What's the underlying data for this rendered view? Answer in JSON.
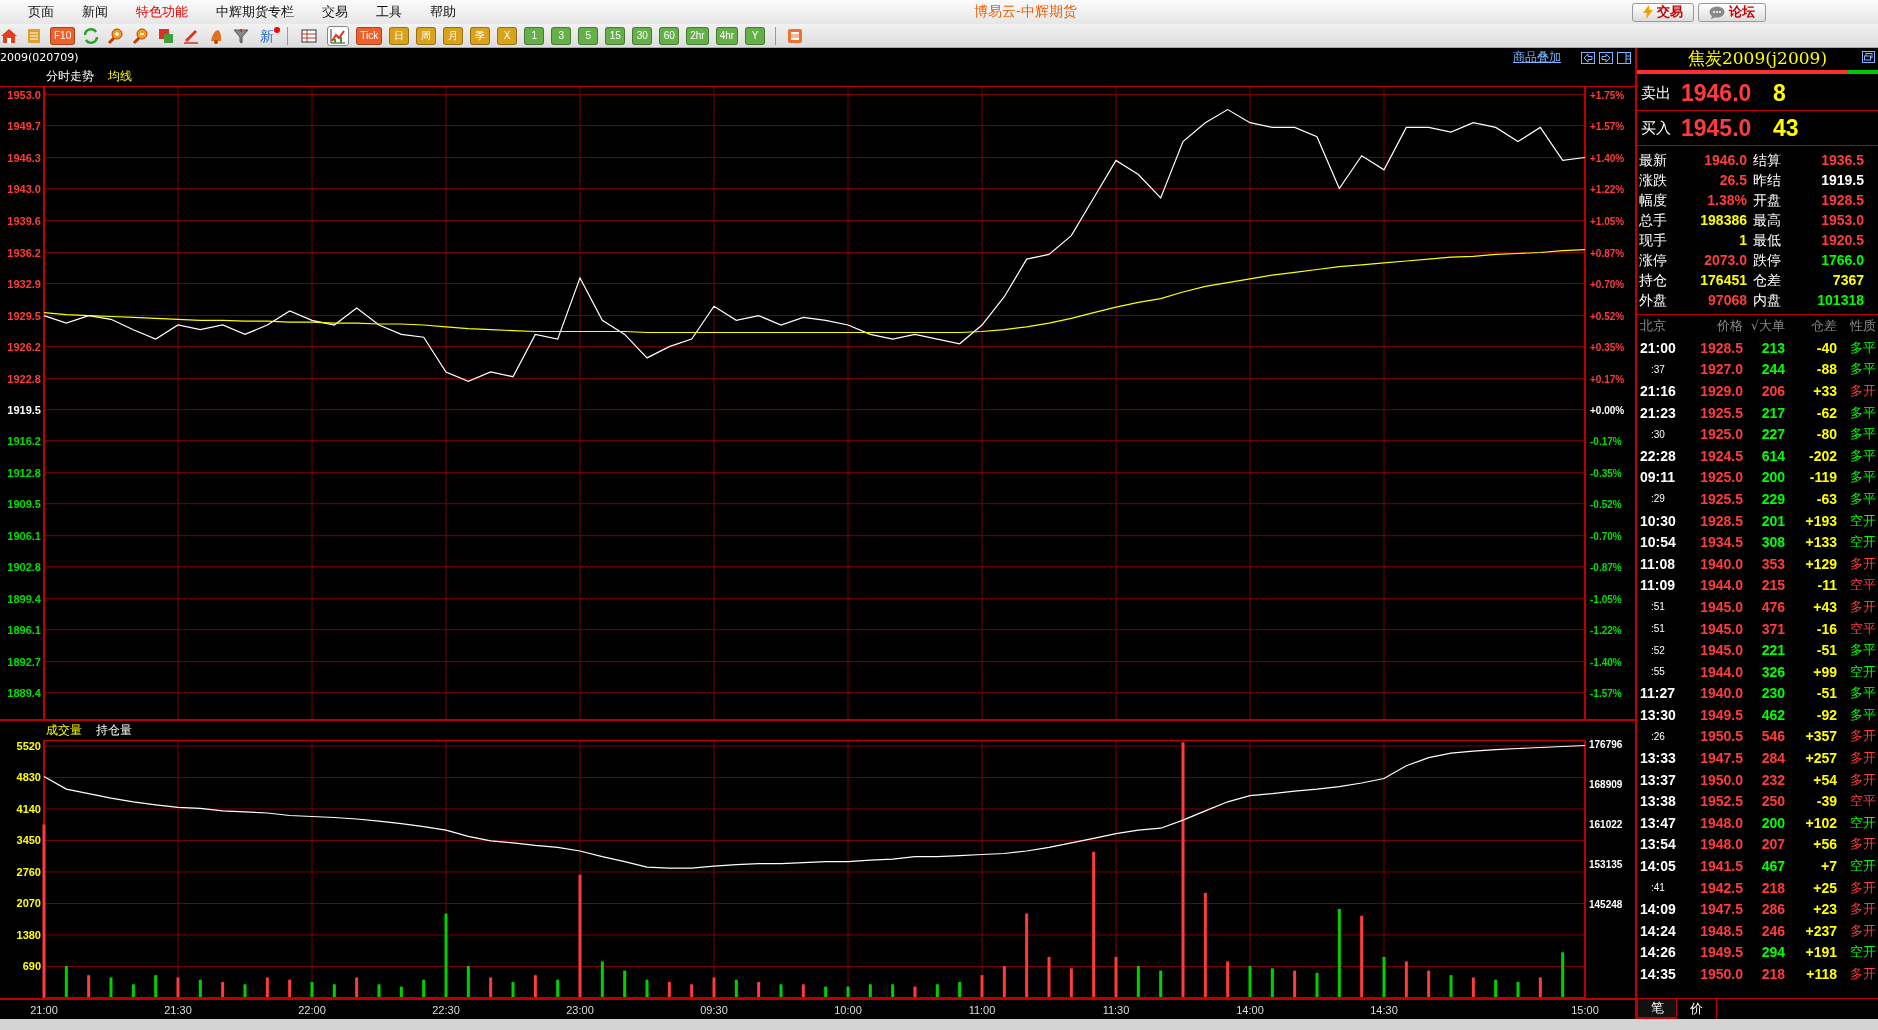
{
  "menu": [
    {
      "label": "页面",
      "highlighted": false
    },
    {
      "label": "新闻",
      "highlighted": false
    },
    {
      "label": "特色功能",
      "highlighted": true
    },
    {
      "label": "中辉期货专栏",
      "highlighted": false
    },
    {
      "label": "交易",
      "highlighted": false
    },
    {
      "label": "工具",
      "highlighted": false
    },
    {
      "label": "帮助",
      "highlighted": false
    }
  ],
  "window": {
    "title": "博易云-中辉期货"
  },
  "header_buttons": [
    {
      "label": "交易"
    },
    {
      "label": "论坛"
    }
  ],
  "toolbar": {
    "f10_label": "F10",
    "news_label": "新",
    "views": [
      {
        "selected": false
      },
      {
        "selected": true
      }
    ],
    "periods": [
      {
        "label": "Tick",
        "kind": "tick"
      },
      {
        "label": "日",
        "kind": "calendar"
      },
      {
        "label": "周",
        "kind": "calendar"
      },
      {
        "label": "月",
        "kind": "calendar"
      },
      {
        "label": "季",
        "kind": "calendar"
      },
      {
        "label": "X",
        "kind": "calendar"
      },
      {
        "label": "1",
        "kind": "minute"
      },
      {
        "label": "3",
        "kind": "minute"
      },
      {
        "label": "5",
        "kind": "minute"
      },
      {
        "label": "15",
        "kind": "minute"
      },
      {
        "label": "30",
        "kind": "minute"
      },
      {
        "label": "60",
        "kind": "minute"
      },
      {
        "label": "2hr",
        "kind": "minute"
      },
      {
        "label": "4hr",
        "kind": "minute"
      },
      {
        "label": "Y",
        "kind": "minute"
      }
    ]
  },
  "chart_title": "2009(020709)",
  "overlay_link": "商品叠加",
  "price_chart": {
    "right_labels": [
      {
        "text": "+1.75%",
        "kind": "up"
      },
      {
        "text": "+1.57%",
        "kind": "up"
      },
      {
        "text": "+1.40%",
        "kind": "up"
      },
      {
        "text": "+1.22%",
        "kind": "up"
      },
      {
        "text": "+1.05%",
        "kind": "up"
      },
      {
        "text": "+0.87%",
        "kind": "up"
      },
      {
        "text": "+0.70%",
        "kind": "up"
      },
      {
        "text": "+0.52%",
        "kind": "up"
      },
      {
        "text": "+0.35%",
        "kind": "up"
      },
      {
        "text": "+0.17%",
        "kind": "up"
      },
      {
        "text": "+0.00%",
        "kind": "flat"
      },
      {
        "text": "-0.17%",
        "kind": "down"
      },
      {
        "text": "-0.35%",
        "kind": "down"
      },
      {
        "text": "-0.52%",
        "kind": "down"
      },
      {
        "text": "-0.70%",
        "kind": "down"
      },
      {
        "text": "-0.87%",
        "kind": "down"
      },
      {
        "text": "-1.05%",
        "kind": "down"
      },
      {
        "text": "-1.22%",
        "kind": "down"
      },
      {
        "text": "-1.40%",
        "kind": "down"
      },
      {
        "text": "-1.57%",
        "kind": "down"
      }
    ],
    "chart_data": {
      "type": "line",
      "grid": true,
      "ylim": [
        1886.5,
        1953.8
      ],
      "yticks": [
        {
          "value": 1953.0,
          "label": "1953.0"
        },
        1949.7,
        1946.3,
        {
          "value": 1943.0,
          "label": "1943.0"
        },
        1939.6,
        1936.2,
        1932.9,
        1929.5,
        1926.2,
        1922.8,
        1919.5,
        1916.2,
        1912.8,
        1909.5,
        1906.1,
        1902.8,
        1899.4,
        1896.1,
        1892.7,
        1889.4
      ],
      "categories": [
        null,
        null,
        null,
        null,
        null,
        null,
        null,
        null,
        null,
        null,
        null,
        null,
        null,
        null,
        null,
        null,
        null,
        null,
        null,
        null,
        null,
        null,
        null,
        null,
        null,
        null,
        null,
        null,
        null,
        null,
        null,
        null,
        null,
        null,
        null,
        null,
        null,
        null,
        null,
        null,
        null,
        null,
        null,
        null,
        null,
        null,
        null,
        null,
        null,
        null,
        null,
        null,
        null,
        null,
        null,
        null,
        null,
        null,
        null,
        null,
        null,
        null,
        null,
        null,
        null,
        null,
        null,
        null,
        null,
        null
      ],
      "series": [
        {
          "name": "分时走势",
          "color": "#ffffff",
          "values": [
            1929.5,
            1928.7,
            1929.5,
            1929.1,
            1928.0,
            1927.0,
            1928.5,
            1928.0,
            1928.5,
            1927.5,
            1928.5,
            1930.0,
            1929.0,
            1928.5,
            1930.3,
            1928.5,
            1927.5,
            1927.2,
            1923.5,
            1922.5,
            1923.5,
            1923.0,
            1927.5,
            1927.0,
            1933.5,
            1929.0,
            1927.5,
            1925.0,
            1926.2,
            1927.0,
            1930.5,
            1929.0,
            1929.5,
            1928.5,
            1929.3,
            1929.0,
            1928.5,
            1927.5,
            1927.0,
            1927.5,
            1927.0,
            1926.5,
            1928.5,
            1931.5,
            1935.5,
            1936.0,
            1938.0,
            1942.0,
            1946.0,
            1944.5,
            1942.0,
            1948.0,
            1950.0,
            1951.4,
            1950.0,
            1949.5,
            1949.5,
            1948.5,
            1943.0,
            1946.5,
            1945.0,
            1949.5,
            1949.5,
            1949.0,
            1950.0,
            1949.5,
            1948.0,
            1949.5,
            1946.0,
            1946.3
          ]
        },
        {
          "name": "均线",
          "color": "#ffff00",
          "values": [
            1929.8,
            1929.6,
            1929.5,
            1929.4,
            1929.3,
            1929.2,
            1929.1,
            1929.0,
            1929.0,
            1928.9,
            1928.9,
            1928.8,
            1928.8,
            1928.7,
            1928.7,
            1928.6,
            1928.6,
            1928.5,
            1928.3,
            1928.1,
            1928.0,
            1927.9,
            1927.8,
            1927.8,
            1927.8,
            1927.8,
            1927.8,
            1927.7,
            1927.7,
            1927.7,
            1927.7,
            1927.7,
            1927.7,
            1927.7,
            1927.7,
            1927.7,
            1927.7,
            1927.7,
            1927.7,
            1927.7,
            1927.7,
            1927.7,
            1927.8,
            1928.0,
            1928.3,
            1928.7,
            1929.2,
            1929.8,
            1930.4,
            1930.9,
            1931.3,
            1932.0,
            1932.6,
            1933.0,
            1933.4,
            1933.8,
            1934.1,
            1934.4,
            1934.7,
            1934.9,
            1935.1,
            1935.3,
            1935.5,
            1935.7,
            1935.8,
            1936.0,
            1936.1,
            1936.2,
            1936.4,
            1936.5
          ]
        }
      ]
    }
  },
  "volume_chart": {
    "chart_data": {
      "type": "bar",
      "grid": true,
      "ylim": [
        0,
        5650
      ],
      "yticks": [
        5520,
        4830,
        4140,
        3450,
        2760,
        2070,
        1380,
        690
      ],
      "categories": [
        "21:00",
        null,
        null,
        null,
        null,
        null,
        "21:30",
        null,
        null,
        null,
        null,
        null,
        "22:00",
        null,
        null,
        null,
        null,
        null,
        "22:30",
        null,
        null,
        null,
        null,
        null,
        "23:00",
        null,
        null,
        null,
        null,
        null,
        "09:30",
        null,
        null,
        null,
        null,
        null,
        "10:00",
        null,
        null,
        null,
        null,
        null,
        "11:00",
        null,
        null,
        null,
        null,
        null,
        "11:30",
        null,
        null,
        null,
        null,
        null,
        "14:00",
        null,
        null,
        null,
        null,
        null,
        "14:30",
        null,
        null,
        null,
        null,
        null,
        null,
        null,
        null,
        "15:00"
      ],
      "series": [
        {
          "name": "成交量",
          "color": "#ff3c3c",
          "values": [
            3800,
            null,
            500,
            null,
            null,
            null,
            450,
            null,
            350,
            null,
            450,
            400,
            null,
            null,
            450,
            null,
            null,
            null,
            null,
            null,
            450,
            null,
            500,
            null,
            2700,
            null,
            null,
            null,
            350,
            300,
            450,
            null,
            350,
            null,
            300,
            null,
            null,
            null,
            null,
            250,
            null,
            null,
            500,
            700,
            1850,
            900,
            650,
            3200,
            900,
            null,
            null,
            5600,
            2300,
            800,
            null,
            null,
            600,
            null,
            null,
            1800,
            null,
            800,
            600,
            null,
            450,
            null,
            null,
            450,
            null,
            null
          ]
        },
        {
          "color": "#00d000",
          "values": [
            null,
            700,
            null,
            450,
            300,
            500,
            null,
            400,
            null,
            300,
            null,
            null,
            350,
            300,
            null,
            300,
            250,
            400,
            1850,
            700,
            null,
            350,
            null,
            400,
            null,
            800,
            600,
            400,
            null,
            null,
            null,
            400,
            null,
            300,
            null,
            250,
            250,
            300,
            300,
            null,
            300,
            350,
            null,
            null,
            null,
            null,
            null,
            null,
            null,
            700,
            600,
            null,
            null,
            null,
            700,
            650,
            null,
            550,
            1950,
            null,
            900,
            null,
            null,
            500,
            null,
            400,
            350,
            null,
            1000,
            null
          ]
        }
      ]
    },
    "open_interest": {
      "chart_data": {
        "type": "line",
        "ylim": [
          126711,
          177585
        ],
        "yticks": [
          176796,
          168909,
          161022,
          153135,
          145248
        ],
        "categories": [
          null,
          null,
          null,
          null,
          null,
          null,
          null,
          null,
          null,
          null,
          null,
          null,
          null,
          null,
          null,
          null,
          null,
          null,
          null,
          null,
          null,
          null,
          null,
          null,
          null,
          null,
          null,
          null,
          null,
          null,
          null,
          null,
          null,
          null,
          null,
          null,
          null,
          null,
          null,
          null,
          null,
          null,
          null,
          null,
          null,
          null,
          null,
          null,
          null,
          null,
          null,
          null,
          null,
          null,
          null,
          null,
          null,
          null,
          null,
          null,
          null,
          null,
          null,
          null,
          null,
          null,
          null,
          null,
          null,
          null
        ],
        "series": [
          {
            "name": "持仓量",
            "color": "#ffffff",
            "values": [
              170400,
              167900,
              167000,
              166100,
              165400,
              164800,
              164300,
              164100,
              163600,
              163400,
              163200,
              162700,
              162500,
              162300,
              162000,
              161600,
              161100,
              160500,
              159800,
              158600,
              157700,
              157300,
              156800,
              156400,
              155700,
              154600,
              153600,
              152500,
              152300,
              152300,
              152700,
              153000,
              153200,
              153200,
              153400,
              153600,
              153600,
              153900,
              154100,
              154600,
              154600,
              154800,
              155000,
              155200,
              155700,
              156400,
              157300,
              158200,
              159100,
              159800,
              160200,
              161800,
              163600,
              165400,
              166600,
              167000,
              167500,
              167900,
              168400,
              169100,
              170000,
              172500,
              174100,
              175000,
              175400,
              175700,
              175900,
              176100,
              176300,
              176500
            ]
          }
        ]
      }
    }
  },
  "quote": {
    "title": "焦炭2009(j2009)",
    "ratio": {
      "level": 0.87
    },
    "ask": {
      "label": "卖出",
      "price": "1946.0",
      "volume": "8"
    },
    "bid": {
      "label": "买入",
      "price": "1945.0",
      "volume": "43"
    },
    "stats": [
      {
        "label": "最新",
        "value": "1946.0",
        "color": "#ff3c3c"
      },
      {
        "label": "结算",
        "value": "1936.5",
        "color": "#ff3c3c"
      },
      {
        "label": "涨跌",
        "value": "26.5",
        "color": "#ff3c3c"
      },
      {
        "label": "昨结",
        "value": "1919.5",
        "color": "#ffffff"
      },
      {
        "label": "幅度",
        "value": "1.38%",
        "color": "#ff3c3c"
      },
      {
        "label": "开盘",
        "value": "1928.5",
        "color": "#ff3c3c"
      },
      {
        "label": "总手",
        "value": "198386",
        "color": "#ffff00"
      },
      {
        "label": "最高",
        "value": "1953.0",
        "color": "#ff3c3c"
      },
      {
        "label": "现手",
        "value": "1",
        "color": "#ffff00"
      },
      {
        "label": "最低",
        "value": "1920.5",
        "color": "#ff3c3c"
      },
      {
        "label": "涨停",
        "value": "2073.0",
        "color": "#ff3c3c"
      },
      {
        "label": "跌停",
        "value": "1766.0",
        "color": "#00ff00"
      },
      {
        "label": "持仓",
        "value": "176451",
        "color": "#ffff00"
      },
      {
        "label": "仓差",
        "value": "7367",
        "color": "#ffff00"
      },
      {
        "label": "外盘",
        "value": "97068",
        "color": "#ff3c3c"
      },
      {
        "label": "内盘",
        "value": "101318",
        "color": "#00ff00"
      }
    ]
  },
  "trades": {
    "columns": [
      "北京",
      "价格",
      "√大单",
      "仓差",
      "性质"
    ],
    "rows": [
      {
        "time": "21:00",
        "kind": "full",
        "price": "1928.5",
        "volume": "213",
        "change": "-40",
        "nature": "多平",
        "color": "#00ff00"
      },
      {
        "time": ":37",
        "kind": "minute",
        "price": "1927.0",
        "volume": "244",
        "change": "-88",
        "nature": "多平",
        "color": "#00ff00"
      },
      {
        "time": "21:16",
        "kind": "full",
        "price": "1929.0",
        "volume": "206",
        "change": "+33",
        "nature": "多开",
        "color": "#ff3c3c"
      },
      {
        "time": "21:23",
        "kind": "full",
        "price": "1925.5",
        "volume": "217",
        "change": "-62",
        "nature": "多平",
        "color": "#00ff00"
      },
      {
        "time": ":30",
        "kind": "minute",
        "price": "1925.0",
        "volume": "227",
        "change": "-80",
        "nature": "多平",
        "color": "#00ff00"
      },
      {
        "time": "22:28",
        "kind": "full",
        "price": "1924.5",
        "volume": "614",
        "change": "-202",
        "nature": "多平",
        "color": "#00ff00"
      },
      {
        "time": "09:11",
        "kind": "full",
        "price": "1925.0",
        "volume": "200",
        "change": "-119",
        "nature": "多平",
        "color": "#00ff00"
      },
      {
        "time": ":29",
        "kind": "minute",
        "price": "1925.5",
        "volume": "229",
        "change": "-63",
        "nature": "多平",
        "color": "#00ff00"
      },
      {
        "time": "10:30",
        "kind": "full",
        "price": "1928.5",
        "volume": "201",
        "change": "+193",
        "nature": "空开",
        "color": "#00ff00"
      },
      {
        "time": "10:54",
        "kind": "full",
        "price": "1934.5",
        "volume": "308",
        "change": "+133",
        "nature": "空开",
        "color": "#00ff00"
      },
      {
        "time": "11:08",
        "kind": "full",
        "price": "1940.0",
        "volume": "353",
        "change": "+129",
        "nature": "多开",
        "color": "#ff3c3c"
      },
      {
        "time": "11:09",
        "kind": "full",
        "price": "1944.0",
        "volume": "215",
        "change": "-11",
        "nature": "空平",
        "color": "#ff3c3c"
      },
      {
        "time": ":51",
        "kind": "minute",
        "price": "1945.0",
        "volume": "476",
        "change": "+43",
        "nature": "多开",
        "color": "#ff3c3c"
      },
      {
        "time": ":51",
        "kind": "minute",
        "price": "1945.0",
        "volume": "371",
        "change": "-16",
        "nature": "空平",
        "color": "#ff3c3c"
      },
      {
        "time": ":52",
        "kind": "minute",
        "price": "1945.0",
        "volume": "221",
        "change": "-51",
        "nature": "多平",
        "color": "#00ff00"
      },
      {
        "time": ":55",
        "kind": "minute",
        "price": "1944.0",
        "volume": "326",
        "change": "+99",
        "nature": "空开",
        "color": "#00ff00"
      },
      {
        "time": "11:27",
        "kind": "full",
        "price": "1940.0",
        "volume": "230",
        "change": "-51",
        "nature": "多平",
        "color": "#00ff00"
      },
      {
        "time": "13:30",
        "kind": "full",
        "price": "1949.5",
        "volume": "462",
        "change": "-92",
        "nature": "多平",
        "color": "#00ff00"
      },
      {
        "time": ":26",
        "kind": "minute",
        "price": "1950.5",
        "volume": "546",
        "change": "+357",
        "nature": "多开",
        "color": "#ff3c3c"
      },
      {
        "time": "13:33",
        "kind": "full",
        "price": "1947.5",
        "volume": "284",
        "change": "+257",
        "nature": "多开",
        "color": "#ff3c3c"
      },
      {
        "time": "13:37",
        "kind": "full",
        "price": "1950.0",
        "volume": "232",
        "change": "+54",
        "nature": "多开",
        "color": "#ff3c3c"
      },
      {
        "time": "13:38",
        "kind": "full",
        "price": "1952.5",
        "volume": "250",
        "change": "-39",
        "nature": "空平",
        "color": "#ff3c3c"
      },
      {
        "time": "13:47",
        "kind": "full",
        "price": "1948.0",
        "volume": "200",
        "change": "+102",
        "nature": "空开",
        "color": "#00ff00"
      },
      {
        "time": "13:54",
        "kind": "full",
        "price": "1948.0",
        "volume": "207",
        "change": "+56",
        "nature": "多开",
        "color": "#ff3c3c"
      },
      {
        "time": "14:05",
        "kind": "full",
        "price": "1941.5",
        "volume": "467",
        "change": "+7",
        "nature": "空开",
        "color": "#00ff00"
      },
      {
        "time": ":41",
        "kind": "minute",
        "price": "1942.5",
        "volume": "218",
        "change": "+25",
        "nature": "多开",
        "color": "#ff3c3c"
      },
      {
        "time": "14:09",
        "kind": "full",
        "price": "1947.5",
        "volume": "286",
        "change": "+23",
        "nature": "多开",
        "color": "#ff3c3c"
      },
      {
        "time": "14:24",
        "kind": "full",
        "price": "1948.5",
        "volume": "246",
        "change": "+237",
        "nature": "多开",
        "color": "#ff3c3c"
      },
      {
        "time": "14:26",
        "kind": "full",
        "price": "1949.5",
        "volume": "294",
        "change": "+191",
        "nature": "空开",
        "color": "#00ff00"
      },
      {
        "time": "14:35",
        "kind": "full",
        "price": "1950.0",
        "volume": "218",
        "change": "+118",
        "nature": "多开",
        "color": "#ff3c3c"
      }
    ]
  },
  "bottom_tabs": [
    {
      "label": "笔",
      "selected": true
    },
    {
      "label": "价",
      "selected": false
    }
  ]
}
